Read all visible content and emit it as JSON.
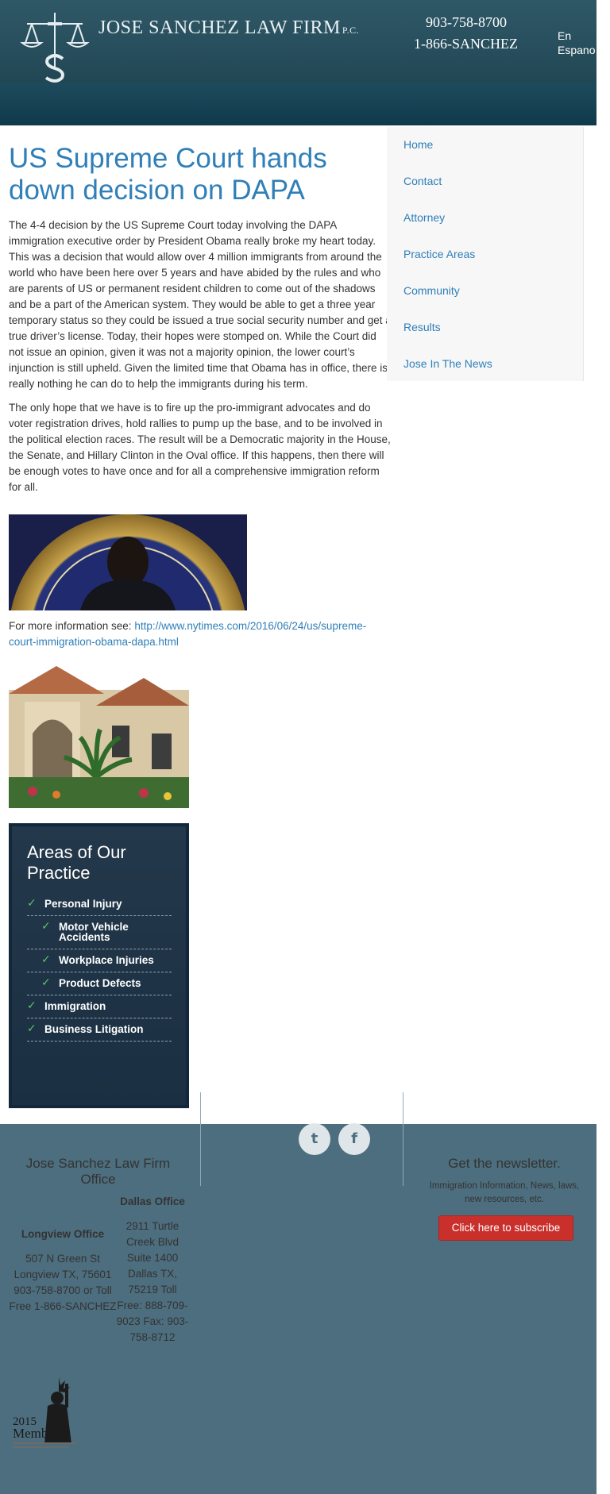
{
  "header": {
    "firm_name": "JOSE SANCHEZ LAW FIRM",
    "firm_suffix": "P.C.",
    "phone_local": "903-758-8700",
    "phone_toll_free": "1-866-SANCHEZ",
    "language_toggle": "En Espano"
  },
  "article": {
    "title": "US Supreme Court hands down decision on DAPA",
    "paragraphs": [
      "The 4-4 decision by the US Supreme Court today involving the DAPA immigration executive order by President Obama really broke my heart today. This was a decision that would allow over 4 million immigrants from around the world who have been here over 5 years and have abided by the rules and who are parents of US or permanent resident children to come out of the shadows and be a part of the American system. They would be able to get a three year temporary status so they could be issued a true social security number and get a true driver’s license. Today, their hopes were stomped on. While the Court did not issue an opinion, given it was not a majority opinion, the lower court’s injunction is still upheld. Given the limited time that Obama has in office, there is really nothing he can do to help the immigrants during his term.",
      "The only hope that we have is to fire up the pro-immigrant advocates and do voter registration drives, hold rallies to pump up the base, and to be involved in the political election races. The result will be a Democratic majority in the House, the Senate, and Hillary Clinton in the Oval office. If this happens, then there will be enough votes to have once and for all a comprehensive immigration reform for all."
    ],
    "more_info_prefix": "For more information see: ",
    "more_info_link": "http://www.nytimes.com/2016/06/24/us/supreme-court-immigration-obama-dapa.html"
  },
  "sidebar": {
    "items": [
      {
        "label": "Home"
      },
      {
        "label": "Contact"
      },
      {
        "label": "Attorney"
      },
      {
        "label": "Practice Areas"
      },
      {
        "label": "Community"
      },
      {
        "label": "Results"
      },
      {
        "label": "Jose In The News"
      }
    ]
  },
  "areas": {
    "title": "Areas of Our Practice",
    "items": [
      {
        "label": "Personal Injury",
        "level": 1
      },
      {
        "label": "Motor Vehicle Accidents",
        "level": 2
      },
      {
        "label": "Workplace Injuries",
        "level": 2
      },
      {
        "label": "Product Defects",
        "level": 2
      },
      {
        "label": "Immigration",
        "level": 1
      },
      {
        "label": "Business Litigation",
        "level": 1
      }
    ],
    "check_color": "#5ec26a"
  },
  "footer": {
    "office_title": "Jose Sanchez Law Firm Office",
    "longview": {
      "heading": "Longview Office",
      "lines": "507 N Green St Longview TX, 75601 903-758-8700 or Toll Free 1-866-SANCHEZ"
    },
    "dallas": {
      "heading": "Dallas Office",
      "lines": "2911 Turtle Creek Blvd Suite 1400 Dallas TX, 75219 Toll Free: 888-709-9023 Fax: 903-758-8712"
    },
    "newsletter_title": "Get the newsletter.",
    "newsletter_sub": "Immigration Information, News, laws, new resources, etc.",
    "subscribe_label": "Click here to subscribe",
    "social": [
      {
        "icon": "twitter-icon",
        "glyph": "t"
      },
      {
        "icon": "facebook-icon",
        "glyph": "f"
      }
    ],
    "member_badge": {
      "year": "2015",
      "word": "Member"
    }
  },
  "colors": {
    "header_bg": "#244a58",
    "link_blue": "#2f7fb8",
    "footer_bg": "#4d6e7e",
    "subscribe_red": "#c9302c",
    "practice_box": "#1b2f42"
  }
}
